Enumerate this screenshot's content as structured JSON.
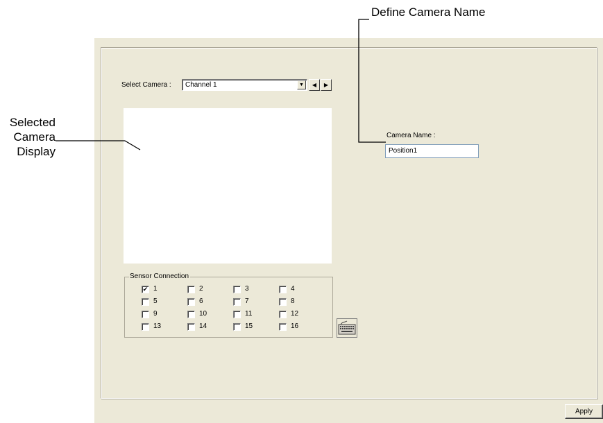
{
  "callouts": {
    "define_camera_name": "Define Camera Name",
    "selected_camera_display": [
      "Selected",
      "Camera",
      "Display"
    ]
  },
  "select_camera": {
    "label": "Select Camera :",
    "value": "Channel 1"
  },
  "camera_name": {
    "label": "Camera Name :",
    "value": "Position1"
  },
  "sensor_connection": {
    "title": "Sensor Connection",
    "sensors": [
      {
        "label": "1",
        "checked": true
      },
      {
        "label": "2",
        "checked": false
      },
      {
        "label": "3",
        "checked": false
      },
      {
        "label": "4",
        "checked": false
      },
      {
        "label": "5",
        "checked": false
      },
      {
        "label": "6",
        "checked": false
      },
      {
        "label": "7",
        "checked": false
      },
      {
        "label": "8",
        "checked": false
      },
      {
        "label": "9",
        "checked": false
      },
      {
        "label": "10",
        "checked": false
      },
      {
        "label": "11",
        "checked": false
      },
      {
        "label": "12",
        "checked": false
      },
      {
        "label": "13",
        "checked": false
      },
      {
        "label": "14",
        "checked": false
      },
      {
        "label": "15",
        "checked": false
      },
      {
        "label": "16",
        "checked": false
      }
    ]
  },
  "buttons": {
    "apply": "Apply"
  },
  "icons": {
    "dropdown": "chevron-down-icon",
    "prev": "arrow-left-icon",
    "next": "arrow-right-icon",
    "keyboard": "keyboard-icon",
    "checkmark": "✔"
  }
}
